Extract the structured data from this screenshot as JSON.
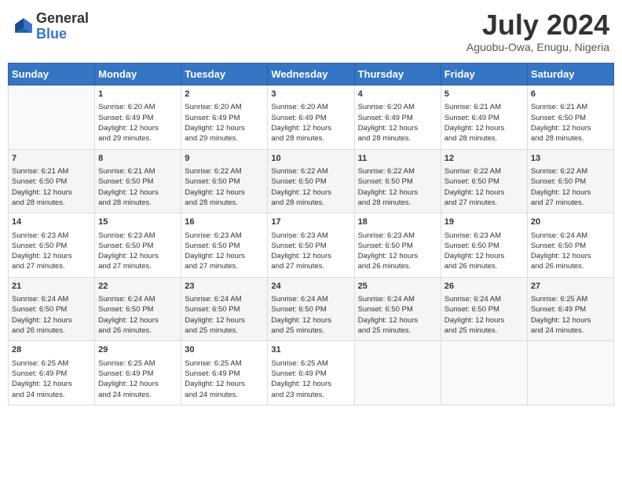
{
  "header": {
    "logo_line1": "General",
    "logo_line2": "Blue",
    "month_year": "July 2024",
    "location": "Aguobu-Owa, Enugu, Nigeria"
  },
  "days_of_week": [
    "Sunday",
    "Monday",
    "Tuesday",
    "Wednesday",
    "Thursday",
    "Friday",
    "Saturday"
  ],
  "weeks": [
    [
      {
        "day": "",
        "content": ""
      },
      {
        "day": "1",
        "content": "Sunrise: 6:20 AM\nSunset: 6:49 PM\nDaylight: 12 hours\nand 29 minutes."
      },
      {
        "day": "2",
        "content": "Sunrise: 6:20 AM\nSunset: 6:49 PM\nDaylight: 12 hours\nand 29 minutes."
      },
      {
        "day": "3",
        "content": "Sunrise: 6:20 AM\nSunset: 6:49 PM\nDaylight: 12 hours\nand 28 minutes."
      },
      {
        "day": "4",
        "content": "Sunrise: 6:20 AM\nSunset: 6:49 PM\nDaylight: 12 hours\nand 28 minutes."
      },
      {
        "day": "5",
        "content": "Sunrise: 6:21 AM\nSunset: 6:49 PM\nDaylight: 12 hours\nand 28 minutes."
      },
      {
        "day": "6",
        "content": "Sunrise: 6:21 AM\nSunset: 6:50 PM\nDaylight: 12 hours\nand 28 minutes."
      }
    ],
    [
      {
        "day": "7",
        "content": "Sunrise: 6:21 AM\nSunset: 6:50 PM\nDaylight: 12 hours\nand 28 minutes."
      },
      {
        "day": "8",
        "content": "Sunrise: 6:21 AM\nSunset: 6:50 PM\nDaylight: 12 hours\nand 28 minutes."
      },
      {
        "day": "9",
        "content": "Sunrise: 6:22 AM\nSunset: 6:50 PM\nDaylight: 12 hours\nand 28 minutes."
      },
      {
        "day": "10",
        "content": "Sunrise: 6:22 AM\nSunset: 6:50 PM\nDaylight: 12 hours\nand 28 minutes."
      },
      {
        "day": "11",
        "content": "Sunrise: 6:22 AM\nSunset: 6:50 PM\nDaylight: 12 hours\nand 28 minutes."
      },
      {
        "day": "12",
        "content": "Sunrise: 6:22 AM\nSunset: 6:50 PM\nDaylight: 12 hours\nand 27 minutes."
      },
      {
        "day": "13",
        "content": "Sunrise: 6:22 AM\nSunset: 6:50 PM\nDaylight: 12 hours\nand 27 minutes."
      }
    ],
    [
      {
        "day": "14",
        "content": "Sunrise: 6:23 AM\nSunset: 6:50 PM\nDaylight: 12 hours\nand 27 minutes."
      },
      {
        "day": "15",
        "content": "Sunrise: 6:23 AM\nSunset: 6:50 PM\nDaylight: 12 hours\nand 27 minutes."
      },
      {
        "day": "16",
        "content": "Sunrise: 6:23 AM\nSunset: 6:50 PM\nDaylight: 12 hours\nand 27 minutes."
      },
      {
        "day": "17",
        "content": "Sunrise: 6:23 AM\nSunset: 6:50 PM\nDaylight: 12 hours\nand 27 minutes."
      },
      {
        "day": "18",
        "content": "Sunrise: 6:23 AM\nSunset: 6:50 PM\nDaylight: 12 hours\nand 26 minutes."
      },
      {
        "day": "19",
        "content": "Sunrise: 6:23 AM\nSunset: 6:50 PM\nDaylight: 12 hours\nand 26 minutes."
      },
      {
        "day": "20",
        "content": "Sunrise: 6:24 AM\nSunset: 6:50 PM\nDaylight: 12 hours\nand 26 minutes."
      }
    ],
    [
      {
        "day": "21",
        "content": "Sunrise: 6:24 AM\nSunset: 6:50 PM\nDaylight: 12 hours\nand 26 minutes."
      },
      {
        "day": "22",
        "content": "Sunrise: 6:24 AM\nSunset: 6:50 PM\nDaylight: 12 hours\nand 26 minutes."
      },
      {
        "day": "23",
        "content": "Sunrise: 6:24 AM\nSunset: 6:50 PM\nDaylight: 12 hours\nand 25 minutes."
      },
      {
        "day": "24",
        "content": "Sunrise: 6:24 AM\nSunset: 6:50 PM\nDaylight: 12 hours\nand 25 minutes."
      },
      {
        "day": "25",
        "content": "Sunrise: 6:24 AM\nSunset: 6:50 PM\nDaylight: 12 hours\nand 25 minutes."
      },
      {
        "day": "26",
        "content": "Sunrise: 6:24 AM\nSunset: 6:50 PM\nDaylight: 12 hours\nand 25 minutes."
      },
      {
        "day": "27",
        "content": "Sunrise: 6:25 AM\nSunset: 6:49 PM\nDaylight: 12 hours\nand 24 minutes."
      }
    ],
    [
      {
        "day": "28",
        "content": "Sunrise: 6:25 AM\nSunset: 6:49 PM\nDaylight: 12 hours\nand 24 minutes."
      },
      {
        "day": "29",
        "content": "Sunrise: 6:25 AM\nSunset: 6:49 PM\nDaylight: 12 hours\nand 24 minutes."
      },
      {
        "day": "30",
        "content": "Sunrise: 6:25 AM\nSunset: 6:49 PM\nDaylight: 12 hours\nand 24 minutes."
      },
      {
        "day": "31",
        "content": "Sunrise: 6:25 AM\nSunset: 6:49 PM\nDaylight: 12 hours\nand 23 minutes."
      },
      {
        "day": "",
        "content": ""
      },
      {
        "day": "",
        "content": ""
      },
      {
        "day": "",
        "content": ""
      }
    ]
  ]
}
